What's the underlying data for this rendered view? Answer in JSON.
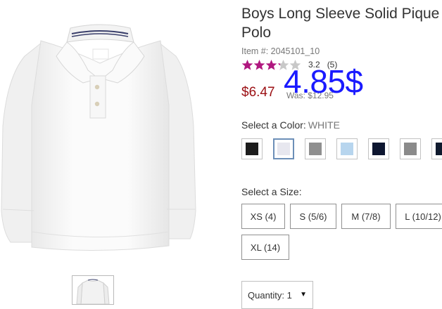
{
  "product": {
    "title_line1": "Boys Long Sleeve Solid Pique",
    "title_line2": "Polo",
    "item_number": "Item #: 2045101_10",
    "rating_score": "3.2",
    "rating_count": "(5)",
    "rating_value": 3.2,
    "price": "$6.47",
    "was_price": "Was: $12.95",
    "overlay_price": "4.85$"
  },
  "color": {
    "label": "Select a Color:",
    "selected": "WHITE",
    "swatches": [
      {
        "name": "black",
        "hex": "#1c1c1c"
      },
      {
        "name": "white",
        "hex": "#e7e7ef"
      },
      {
        "name": "gray",
        "hex": "#8f8f8f"
      },
      {
        "name": "light-blue",
        "hex": "#b7d5ee"
      },
      {
        "name": "navy",
        "hex": "#0d1630"
      },
      {
        "name": "gray-heather",
        "hex": "#8a8a8a"
      },
      {
        "name": "dark-navy",
        "hex": "#0f1a2e"
      }
    ]
  },
  "size": {
    "label": "Select a Size:",
    "options": [
      "XS (4)",
      "S (5/6)",
      "M (7/8)",
      "L (10/12)",
      "XL (14)"
    ]
  },
  "quantity": {
    "label": "Quantity:",
    "value": "1"
  },
  "colors": {
    "price_red": "#9b0f13",
    "star_fill": "#b0177f",
    "star_empty": "#c8c8c8",
    "overlay_blue": "#1a1aff"
  }
}
